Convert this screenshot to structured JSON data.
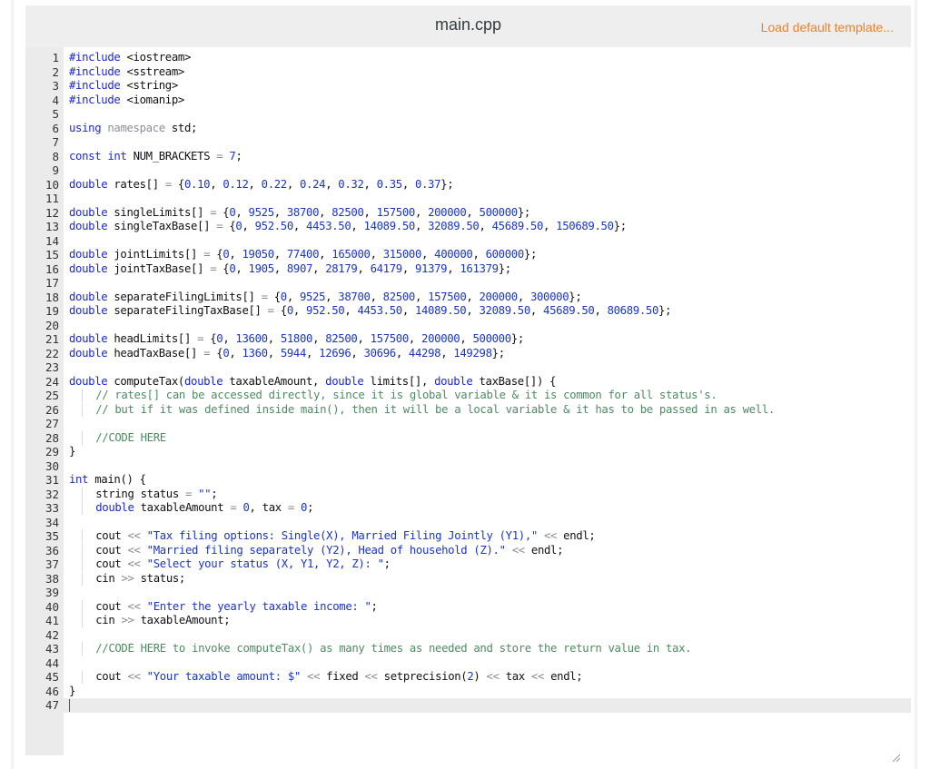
{
  "header": {
    "filename": "main.cpp",
    "load_template_label": "Load default template..."
  },
  "editor": {
    "lines": [
      {
        "n": "1",
        "tokens": [
          [
            "k",
            "#include"
          ],
          [
            "p",
            " <iostream>"
          ]
        ]
      },
      {
        "n": "2",
        "tokens": [
          [
            "k",
            "#include"
          ],
          [
            "p",
            " <sstream>"
          ]
        ]
      },
      {
        "n": "3",
        "tokens": [
          [
            "k",
            "#include"
          ],
          [
            "p",
            " <string>"
          ]
        ]
      },
      {
        "n": "4",
        "tokens": [
          [
            "k",
            "#include"
          ],
          [
            "p",
            " <iomanip>"
          ]
        ]
      },
      {
        "n": "5",
        "tokens": []
      },
      {
        "n": "6",
        "tokens": [
          [
            "k",
            "using"
          ],
          [
            "p",
            " "
          ],
          [
            "dim",
            "namespace"
          ],
          [
            "p",
            " std;"
          ]
        ]
      },
      {
        "n": "7",
        "tokens": []
      },
      {
        "n": "8",
        "tokens": [
          [
            "k",
            "const"
          ],
          [
            "p",
            " "
          ],
          [
            "k",
            "int"
          ],
          [
            "p",
            " NUM_BRACKETS "
          ],
          [
            "op",
            "="
          ],
          [
            "p",
            " "
          ],
          [
            "n",
            "7"
          ],
          [
            "p",
            ";"
          ]
        ]
      },
      {
        "n": "9",
        "tokens": []
      },
      {
        "n": "10",
        "tokens": [
          [
            "k",
            "double"
          ],
          [
            "p",
            " rates[] "
          ],
          [
            "op",
            "="
          ],
          [
            "p",
            " {"
          ],
          [
            "n",
            "0.10"
          ],
          [
            "p",
            ", "
          ],
          [
            "n",
            "0.12"
          ],
          [
            "p",
            ", "
          ],
          [
            "n",
            "0.22"
          ],
          [
            "p",
            ", "
          ],
          [
            "n",
            "0.24"
          ],
          [
            "p",
            ", "
          ],
          [
            "n",
            "0.32"
          ],
          [
            "p",
            ", "
          ],
          [
            "n",
            "0.35"
          ],
          [
            "p",
            ", "
          ],
          [
            "n",
            "0.37"
          ],
          [
            "p",
            "};"
          ]
        ]
      },
      {
        "n": "11",
        "tokens": []
      },
      {
        "n": "12",
        "tokens": [
          [
            "k",
            "double"
          ],
          [
            "p",
            " singleLimits[] "
          ],
          [
            "op",
            "="
          ],
          [
            "p",
            " {"
          ],
          [
            "n",
            "0"
          ],
          [
            "p",
            ", "
          ],
          [
            "n",
            "9525"
          ],
          [
            "p",
            ", "
          ],
          [
            "n",
            "38700"
          ],
          [
            "p",
            ", "
          ],
          [
            "n",
            "82500"
          ],
          [
            "p",
            ", "
          ],
          [
            "n",
            "157500"
          ],
          [
            "p",
            ", "
          ],
          [
            "n",
            "200000"
          ],
          [
            "p",
            ", "
          ],
          [
            "n",
            "500000"
          ],
          [
            "p",
            "};"
          ]
        ]
      },
      {
        "n": "13",
        "tokens": [
          [
            "k",
            "double"
          ],
          [
            "p",
            " singleTaxBase[] "
          ],
          [
            "op",
            "="
          ],
          [
            "p",
            " {"
          ],
          [
            "n",
            "0"
          ],
          [
            "p",
            ", "
          ],
          [
            "n",
            "952.50"
          ],
          [
            "p",
            ", "
          ],
          [
            "n",
            "4453.50"
          ],
          [
            "p",
            ", "
          ],
          [
            "n",
            "14089.50"
          ],
          [
            "p",
            ", "
          ],
          [
            "n",
            "32089.50"
          ],
          [
            "p",
            ", "
          ],
          [
            "n",
            "45689.50"
          ],
          [
            "p",
            ", "
          ],
          [
            "n",
            "150689.50"
          ],
          [
            "p",
            "};"
          ]
        ]
      },
      {
        "n": "14",
        "tokens": []
      },
      {
        "n": "15",
        "tokens": [
          [
            "k",
            "double"
          ],
          [
            "p",
            " jointLimits[] "
          ],
          [
            "op",
            "="
          ],
          [
            "p",
            " {"
          ],
          [
            "n",
            "0"
          ],
          [
            "p",
            ", "
          ],
          [
            "n",
            "19050"
          ],
          [
            "p",
            ", "
          ],
          [
            "n",
            "77400"
          ],
          [
            "p",
            ", "
          ],
          [
            "n",
            "165000"
          ],
          [
            "p",
            ", "
          ],
          [
            "n",
            "315000"
          ],
          [
            "p",
            ", "
          ],
          [
            "n",
            "400000"
          ],
          [
            "p",
            ", "
          ],
          [
            "n",
            "600000"
          ],
          [
            "p",
            "};"
          ]
        ]
      },
      {
        "n": "16",
        "tokens": [
          [
            "k",
            "double"
          ],
          [
            "p",
            " jointTaxBase[] "
          ],
          [
            "op",
            "="
          ],
          [
            "p",
            " {"
          ],
          [
            "n",
            "0"
          ],
          [
            "p",
            ", "
          ],
          [
            "n",
            "1905"
          ],
          [
            "p",
            ", "
          ],
          [
            "n",
            "8907"
          ],
          [
            "p",
            ", "
          ],
          [
            "n",
            "28179"
          ],
          [
            "p",
            ", "
          ],
          [
            "n",
            "64179"
          ],
          [
            "p",
            ", "
          ],
          [
            "n",
            "91379"
          ],
          [
            "p",
            ", "
          ],
          [
            "n",
            "161379"
          ],
          [
            "p",
            "};"
          ]
        ]
      },
      {
        "n": "17",
        "tokens": []
      },
      {
        "n": "18",
        "tokens": [
          [
            "k",
            "double"
          ],
          [
            "p",
            " separateFilingLimits[] "
          ],
          [
            "op",
            "="
          ],
          [
            "p",
            " {"
          ],
          [
            "n",
            "0"
          ],
          [
            "p",
            ", "
          ],
          [
            "n",
            "9525"
          ],
          [
            "p",
            ", "
          ],
          [
            "n",
            "38700"
          ],
          [
            "p",
            ", "
          ],
          [
            "n",
            "82500"
          ],
          [
            "p",
            ", "
          ],
          [
            "n",
            "157500"
          ],
          [
            "p",
            ", "
          ],
          [
            "n",
            "200000"
          ],
          [
            "p",
            ", "
          ],
          [
            "n",
            "300000"
          ],
          [
            "p",
            "};"
          ]
        ]
      },
      {
        "n": "19",
        "tokens": [
          [
            "k",
            "double"
          ],
          [
            "p",
            " separateFilingTaxBase[] "
          ],
          [
            "op",
            "="
          ],
          [
            "p",
            " {"
          ],
          [
            "n",
            "0"
          ],
          [
            "p",
            ", "
          ],
          [
            "n",
            "952.50"
          ],
          [
            "p",
            ", "
          ],
          [
            "n",
            "4453.50"
          ],
          [
            "p",
            ", "
          ],
          [
            "n",
            "14089.50"
          ],
          [
            "p",
            ", "
          ],
          [
            "n",
            "32089.50"
          ],
          [
            "p",
            ", "
          ],
          [
            "n",
            "45689.50"
          ],
          [
            "p",
            ", "
          ],
          [
            "n",
            "80689.50"
          ],
          [
            "p",
            "};"
          ]
        ]
      },
      {
        "n": "20",
        "tokens": []
      },
      {
        "n": "21",
        "tokens": [
          [
            "k",
            "double"
          ],
          [
            "p",
            " headLimits[] "
          ],
          [
            "op",
            "="
          ],
          [
            "p",
            " {"
          ],
          [
            "n",
            "0"
          ],
          [
            "p",
            ", "
          ],
          [
            "n",
            "13600"
          ],
          [
            "p",
            ", "
          ],
          [
            "n",
            "51800"
          ],
          [
            "p",
            ", "
          ],
          [
            "n",
            "82500"
          ],
          [
            "p",
            ", "
          ],
          [
            "n",
            "157500"
          ],
          [
            "p",
            ", "
          ],
          [
            "n",
            "200000"
          ],
          [
            "p",
            ", "
          ],
          [
            "n",
            "500000"
          ],
          [
            "p",
            "};"
          ]
        ]
      },
      {
        "n": "22",
        "tokens": [
          [
            "k",
            "double"
          ],
          [
            "p",
            " headTaxBase[] "
          ],
          [
            "op",
            "="
          ],
          [
            "p",
            " {"
          ],
          [
            "n",
            "0"
          ],
          [
            "p",
            ", "
          ],
          [
            "n",
            "1360"
          ],
          [
            "p",
            ", "
          ],
          [
            "n",
            "5944"
          ],
          [
            "p",
            ", "
          ],
          [
            "n",
            "12696"
          ],
          [
            "p",
            ", "
          ],
          [
            "n",
            "30696"
          ],
          [
            "p",
            ", "
          ],
          [
            "n",
            "44298"
          ],
          [
            "p",
            ", "
          ],
          [
            "n",
            "149298"
          ],
          [
            "p",
            "};"
          ]
        ]
      },
      {
        "n": "23",
        "tokens": []
      },
      {
        "n": "24",
        "tokens": [
          [
            "k",
            "double"
          ],
          [
            "p",
            " computeTax("
          ],
          [
            "k",
            "double"
          ],
          [
            "p",
            " taxableAmount, "
          ],
          [
            "k",
            "double"
          ],
          [
            "p",
            " limits[], "
          ],
          [
            "k",
            "double"
          ],
          [
            "p",
            " taxBase[]) {"
          ]
        ]
      },
      {
        "n": "25",
        "indent": true,
        "tokens": [
          [
            "c",
            "// rates[] can be accessed directly, since it is global variable & it is common for all status's."
          ]
        ]
      },
      {
        "n": "26",
        "indent": true,
        "tokens": [
          [
            "c",
            "// but if it was defined inside main(), then it will be a local variable & it has to be passed in as well."
          ]
        ]
      },
      {
        "n": "27",
        "tokens": []
      },
      {
        "n": "28",
        "indent": true,
        "tokens": [
          [
            "c",
            "//CODE HERE"
          ]
        ]
      },
      {
        "n": "29",
        "tokens": [
          [
            "p",
            "}"
          ]
        ]
      },
      {
        "n": "30",
        "tokens": []
      },
      {
        "n": "31",
        "tokens": [
          [
            "k",
            "int"
          ],
          [
            "p",
            " main() {"
          ]
        ]
      },
      {
        "n": "32",
        "indent": true,
        "tokens": [
          [
            "p",
            "string status "
          ],
          [
            "op",
            "="
          ],
          [
            "p",
            " "
          ],
          [
            "s",
            "\"\""
          ],
          [
            "p",
            ";"
          ]
        ]
      },
      {
        "n": "33",
        "indent": true,
        "tokens": [
          [
            "k",
            "double"
          ],
          [
            "p",
            " taxableAmount "
          ],
          [
            "op",
            "="
          ],
          [
            "p",
            " "
          ],
          [
            "n",
            "0"
          ],
          [
            "p",
            ", tax "
          ],
          [
            "op",
            "="
          ],
          [
            "p",
            " "
          ],
          [
            "n",
            "0"
          ],
          [
            "p",
            ";"
          ]
        ]
      },
      {
        "n": "34",
        "tokens": []
      },
      {
        "n": "35",
        "indent": true,
        "tokens": [
          [
            "p",
            "cout "
          ],
          [
            "op",
            "<<"
          ],
          [
            "p",
            " "
          ],
          [
            "s",
            "\"Tax filing options: Single(X), Married Filing Jointly (Y1),\""
          ],
          [
            "p",
            " "
          ],
          [
            "op",
            "<<"
          ],
          [
            "p",
            " endl;"
          ]
        ]
      },
      {
        "n": "36",
        "indent": true,
        "tokens": [
          [
            "p",
            "cout "
          ],
          [
            "op",
            "<<"
          ],
          [
            "p",
            " "
          ],
          [
            "s",
            "\"Married filing separately (Y2), Head of household (Z).\""
          ],
          [
            "p",
            " "
          ],
          [
            "op",
            "<<"
          ],
          [
            "p",
            " endl;"
          ]
        ]
      },
      {
        "n": "37",
        "indent": true,
        "tokens": [
          [
            "p",
            "cout "
          ],
          [
            "op",
            "<<"
          ],
          [
            "p",
            " "
          ],
          [
            "s",
            "\"Select your status (X, Y1, Y2, Z): \""
          ],
          [
            "p",
            ";"
          ]
        ]
      },
      {
        "n": "38",
        "indent": true,
        "tokens": [
          [
            "p",
            "cin "
          ],
          [
            "op",
            ">>"
          ],
          [
            "p",
            " status;"
          ]
        ]
      },
      {
        "n": "39",
        "tokens": []
      },
      {
        "n": "40",
        "indent": true,
        "tokens": [
          [
            "p",
            "cout "
          ],
          [
            "op",
            "<<"
          ],
          [
            "p",
            " "
          ],
          [
            "s",
            "\"Enter the yearly taxable income: \""
          ],
          [
            "p",
            ";"
          ]
        ]
      },
      {
        "n": "41",
        "indent": true,
        "tokens": [
          [
            "p",
            "cin "
          ],
          [
            "op",
            ">>"
          ],
          [
            "p",
            " taxableAmount;"
          ]
        ]
      },
      {
        "n": "42",
        "tokens": []
      },
      {
        "n": "43",
        "indent": true,
        "tokens": [
          [
            "c",
            "//CODE HERE to invoke computeTax() as many times as needed and store the return value in tax."
          ]
        ]
      },
      {
        "n": "44",
        "tokens": []
      },
      {
        "n": "45",
        "indent": true,
        "tokens": [
          [
            "p",
            "cout "
          ],
          [
            "op",
            "<<"
          ],
          [
            "p",
            " "
          ],
          [
            "s",
            "\"Your taxable amount: $\""
          ],
          [
            "p",
            " "
          ],
          [
            "op",
            "<<"
          ],
          [
            "p",
            " fixed "
          ],
          [
            "op",
            "<<"
          ],
          [
            "p",
            " setprecision("
          ],
          [
            "n",
            "2"
          ],
          [
            "p",
            ") "
          ],
          [
            "op",
            "<<"
          ],
          [
            "p",
            " tax "
          ],
          [
            "op",
            "<<"
          ],
          [
            "p",
            " endl;"
          ]
        ]
      },
      {
        "n": "46",
        "tokens": [
          [
            "p",
            "}"
          ]
        ]
      },
      {
        "n": "47",
        "active": true,
        "cursor": true,
        "tokens": []
      }
    ]
  }
}
